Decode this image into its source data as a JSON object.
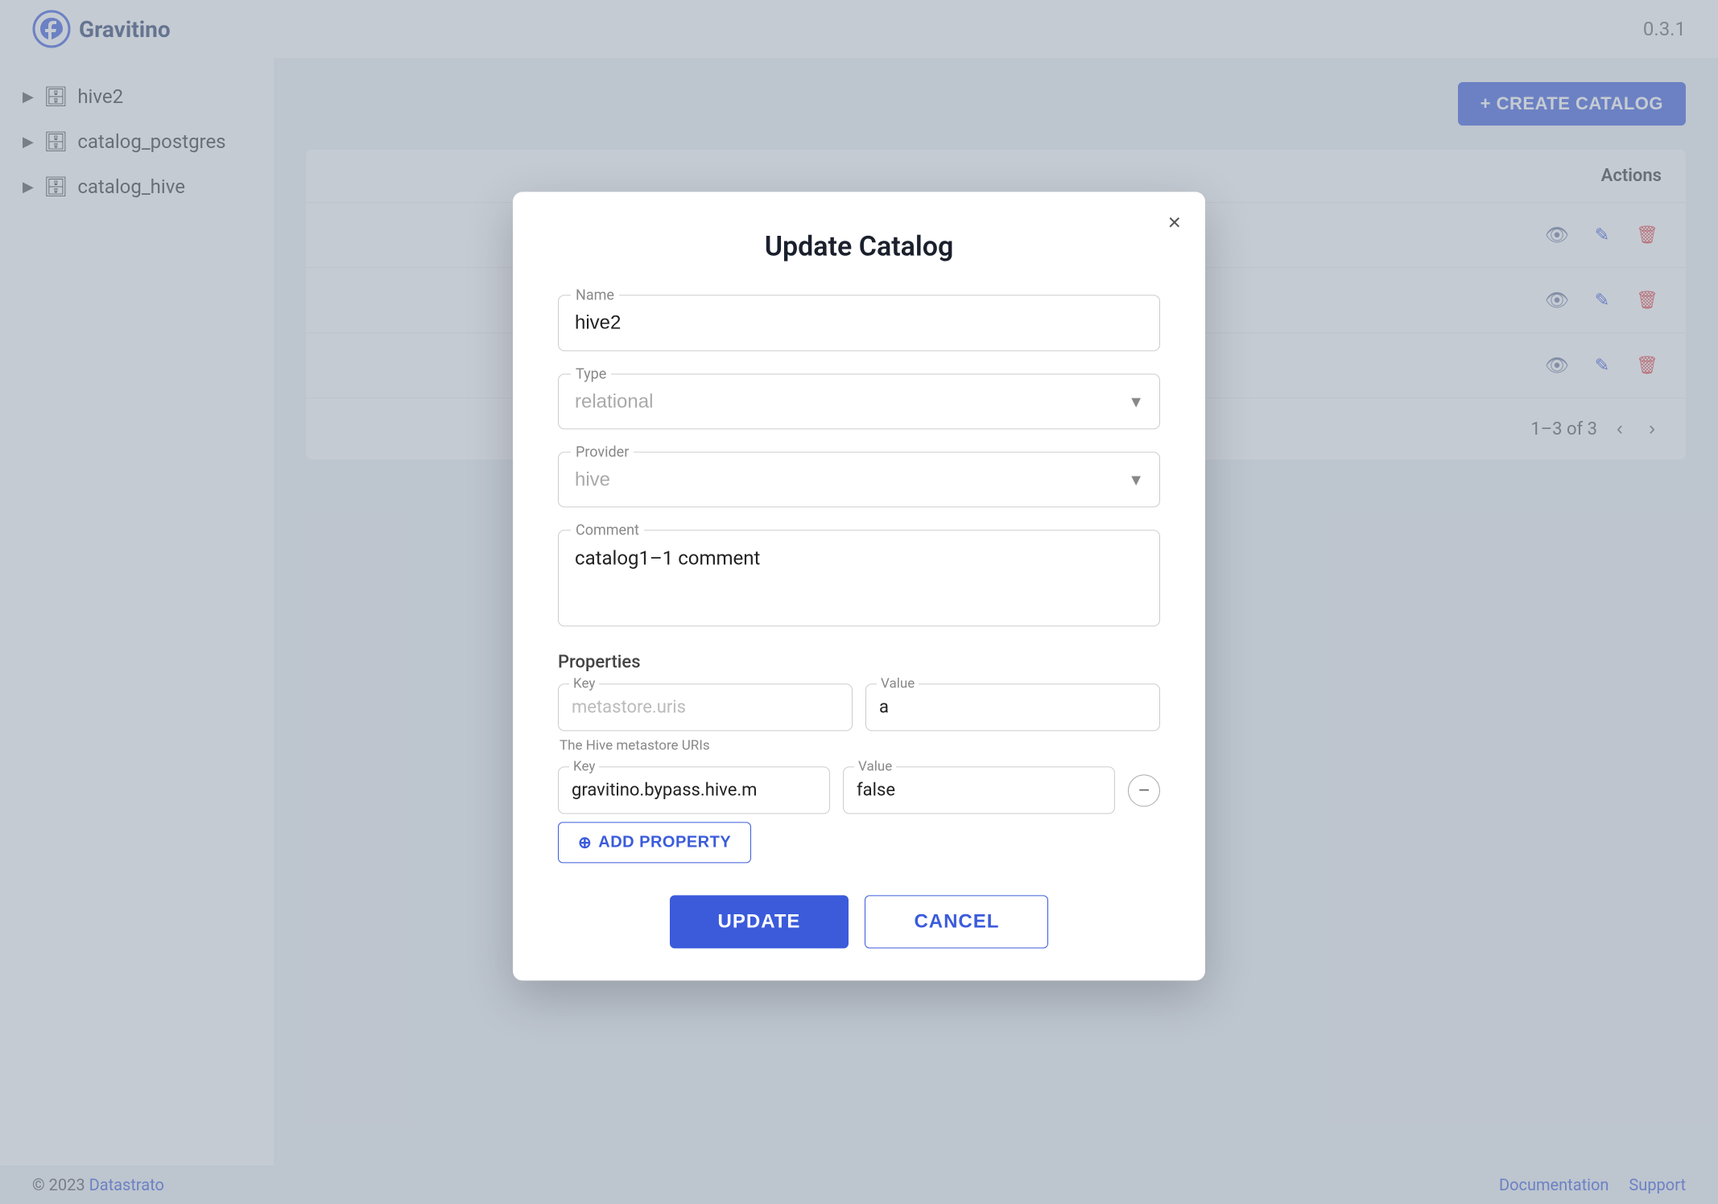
{
  "header": {
    "logo_text": "Gravitino",
    "version": "0.3.1"
  },
  "sidebar": {
    "items": [
      {
        "label": "hive2",
        "arrow": "▶",
        "icon": "🗄"
      },
      {
        "label": "catalog_postgres",
        "arrow": "▶",
        "icon": "🗄"
      },
      {
        "label": "catalog_hive",
        "arrow": "▶",
        "icon": "🗄"
      }
    ]
  },
  "toolbar": {
    "create_catalog_label": "+ CREATE CATALOG"
  },
  "table": {
    "actions_header": "Actions",
    "pagination_text": "1–3 of 3"
  },
  "footer": {
    "copyright": "© 2023",
    "company": "Datastrato",
    "links": [
      "Documentation",
      "Support"
    ]
  },
  "modal": {
    "title": "Update Catalog",
    "close_label": "×",
    "name_label": "Name",
    "name_value": "hive2",
    "type_label": "Type",
    "type_placeholder": "relational",
    "provider_label": "Provider",
    "provider_placeholder": "hive",
    "comment_label": "Comment",
    "comment_value": "catalog1–1 comment",
    "properties_label": "Properties",
    "property1": {
      "key_label": "Key",
      "key_placeholder": "metastore.uris",
      "value_label": "Value",
      "value_value": "a",
      "hint": "The Hive metastore URIs"
    },
    "property2": {
      "key_label": "Key",
      "key_value": "gravitino.bypass.hive.m",
      "value_label": "Value",
      "value_value": "false"
    },
    "add_property_label": "ADD PROPERTY",
    "update_button": "UPDATE",
    "cancel_button": "CANCEL"
  }
}
